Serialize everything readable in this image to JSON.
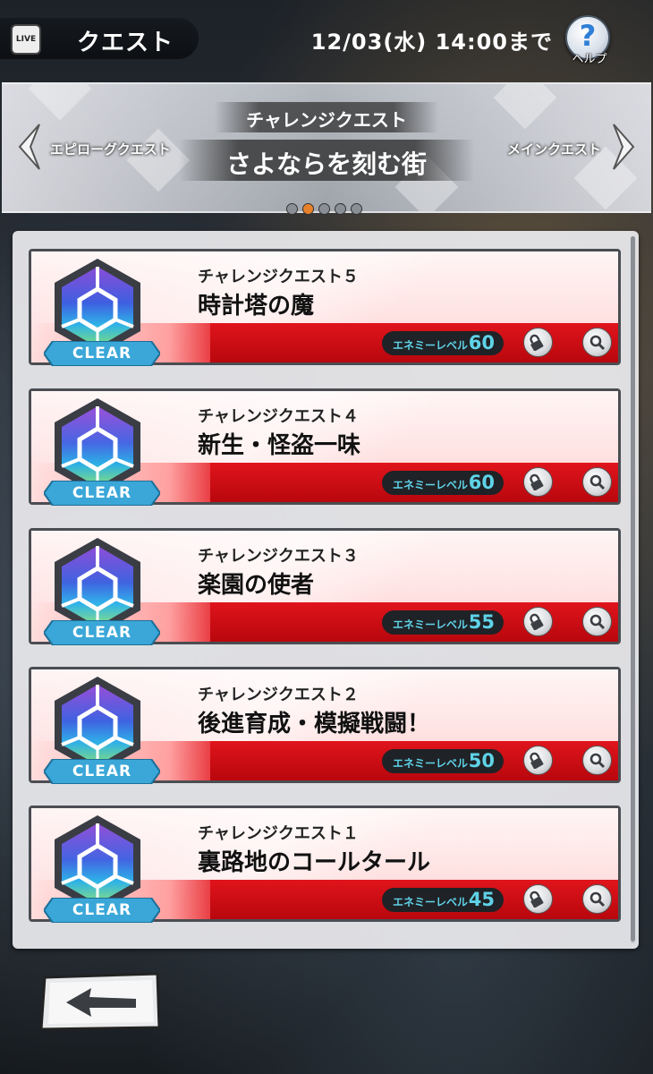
{
  "header": {
    "live_icon_text": "LIVE",
    "title": "クエスト",
    "deadline": "12/03(水) 14:00まで",
    "help_label": "ヘルプ",
    "help_symbol": "?"
  },
  "banner": {
    "category": "チャレンジクエスト",
    "arc_title": "さよならを刻む街",
    "prev_label": "エピローグクエスト",
    "next_label": "メインクエスト",
    "page_count": 5,
    "active_page": 2
  },
  "quests": [
    {
      "subtitle": "チャレンジクエスト５",
      "title": "時計塔の魔",
      "level_label": "エネミーレベル",
      "level": "60",
      "status": "CLEAR"
    },
    {
      "subtitle": "チャレンジクエスト４",
      "title": "新生・怪盗一味",
      "level_label": "エネミーレベル",
      "level": "60",
      "status": "CLEAR"
    },
    {
      "subtitle": "チャレンジクエスト３",
      "title": "楽園の使者",
      "level_label": "エネミーレベル",
      "level": "55",
      "status": "CLEAR"
    },
    {
      "subtitle": "チャレンジクエスト２",
      "title": "後進育成・模擬戦闘！",
      "level_label": "エネミーレベル",
      "level": "50",
      "status": "CLEAR"
    },
    {
      "subtitle": "チャレンジクエスト１",
      "title": "裏路地のコールタール",
      "level_label": "エネミーレベル",
      "level": "45",
      "status": "CLEAR"
    }
  ],
  "icons": {
    "back": "back-arrow-icon",
    "lock": "lock-icon",
    "search": "search-icon",
    "help": "help-icon",
    "gem": "quest-gem-icon"
  },
  "colors": {
    "stripe_red": "#e0141c",
    "level_text": "#5fd3e8",
    "clear_badge": "#3aa7d8",
    "active_dot": "#e8822a"
  }
}
